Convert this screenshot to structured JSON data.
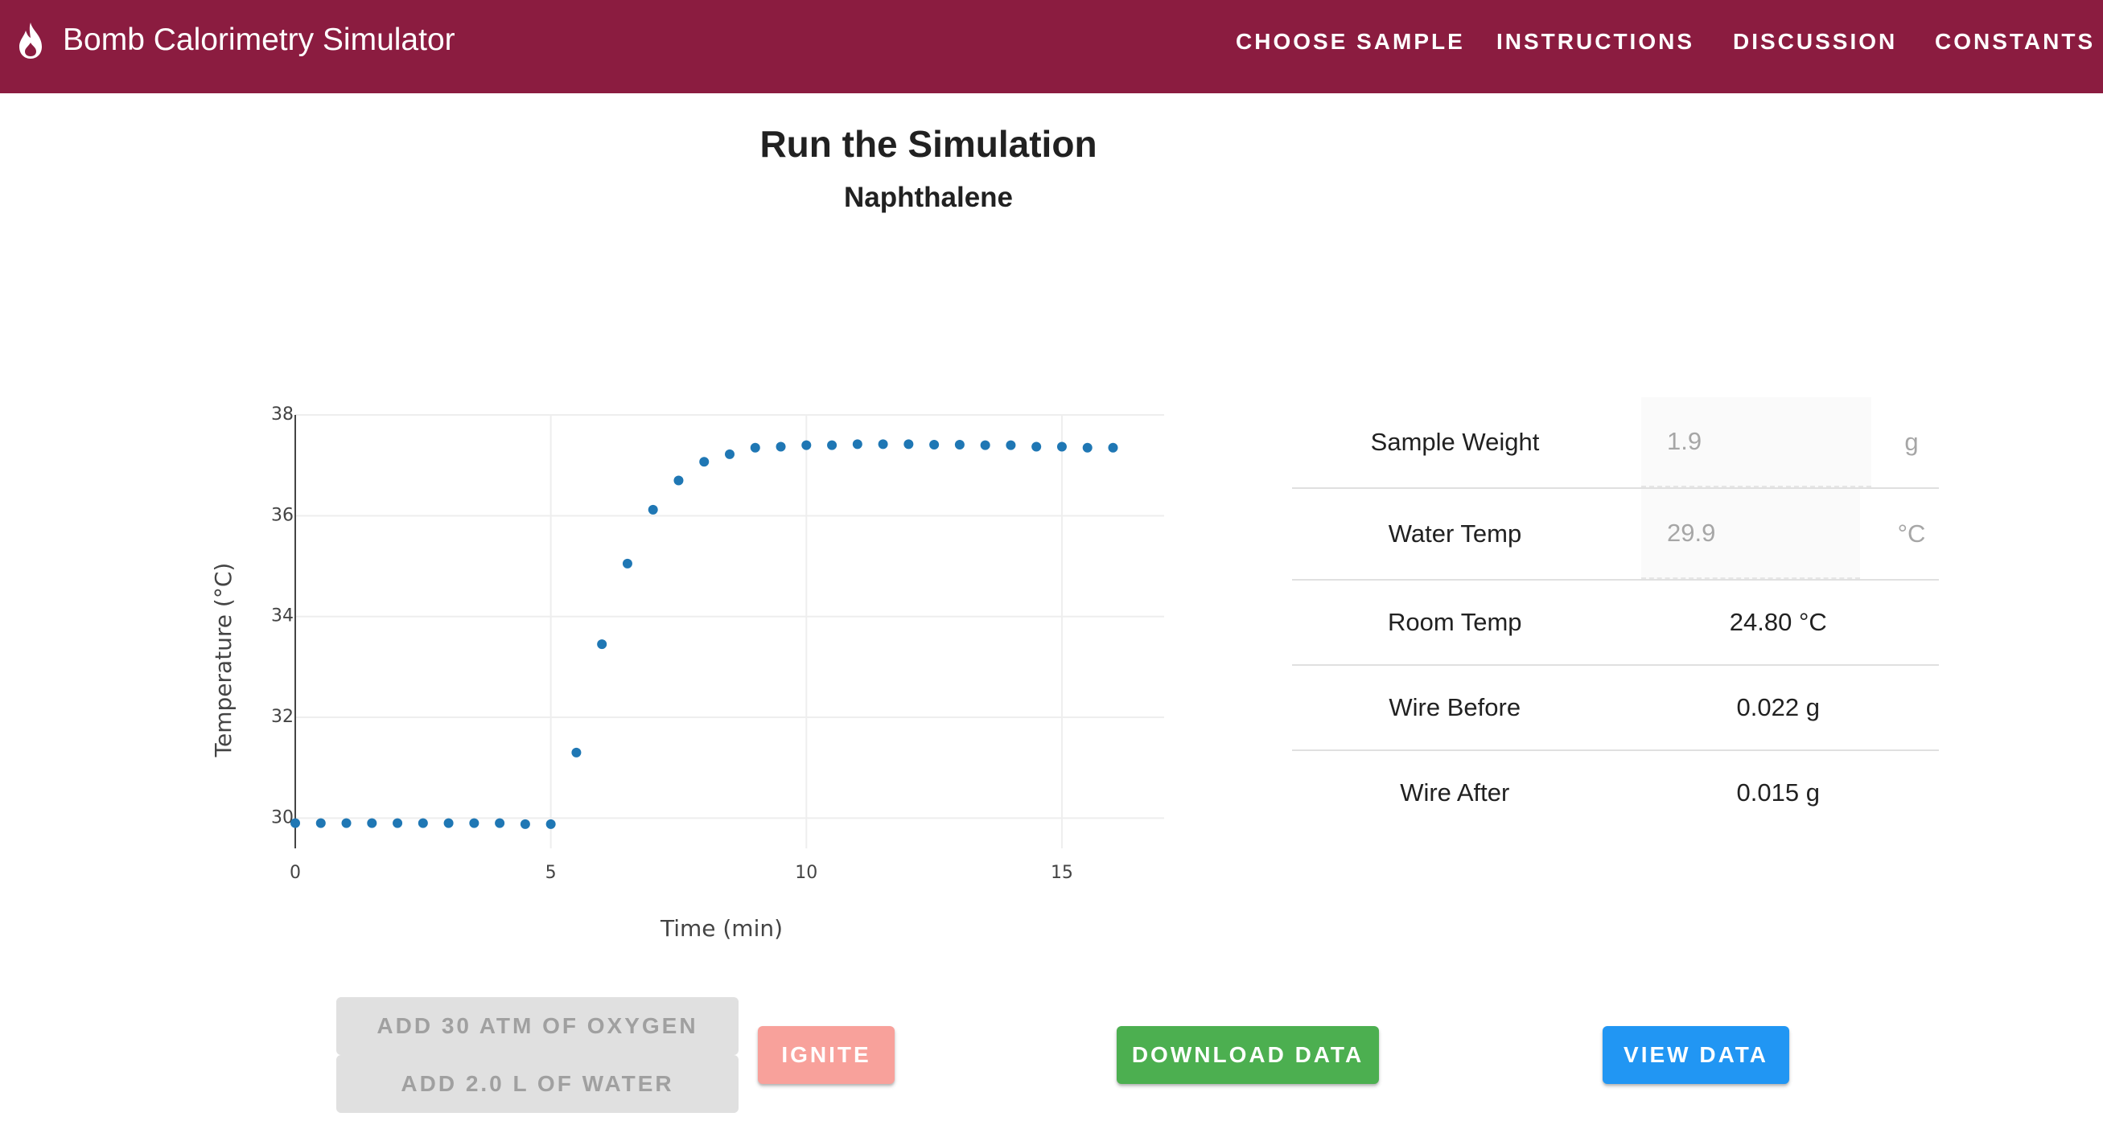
{
  "app": {
    "title": "Bomb Calorimetry Simulator",
    "logo_icon": "flame-icon",
    "brand_color": "#8b1c40"
  },
  "nav": [
    {
      "label": "CHOOSE SAMPLE"
    },
    {
      "label": "INSTRUCTIONS"
    },
    {
      "label": "DISCUSSION"
    },
    {
      "label": "CONSTANTS"
    }
  ],
  "main": {
    "title": "Run the Simulation",
    "sample_name": "Naphthalene"
  },
  "properties": {
    "sample_weight": {
      "label": "Sample Weight",
      "value": "1.9",
      "unit": "g"
    },
    "water_temp": {
      "label": "Water Temp",
      "value": "29.9",
      "unit": "°C"
    },
    "room_temp": {
      "label": "Room Temp",
      "value": "24.80 °C"
    },
    "wire_before": {
      "label": "Wire Before",
      "value": "0.022 g"
    },
    "wire_after": {
      "label": "Wire After",
      "value": "0.015 g"
    }
  },
  "buttons": {
    "add_oxygen": "ADD 30 ATM OF OXYGEN",
    "add_water": "ADD 2.0 L OF WATER",
    "ignite": "IGNITE",
    "download": "DOWNLOAD DATA",
    "view": "VIEW DATA"
  },
  "colors": {
    "marker": "#1f77b4",
    "ignite": "#f8a19b",
    "download": "#4caf50",
    "view": "#2196f3"
  },
  "chart_data": {
    "type": "scatter",
    "xlabel": "Time (min)",
    "ylabel": "Temperature (°C)",
    "xlim": [
      0,
      17
    ],
    "ylim": [
      29.4,
      38
    ],
    "x_ticks": [
      0,
      5,
      10,
      15
    ],
    "y_ticks": [
      30,
      32,
      34,
      36,
      38
    ],
    "grid": true,
    "legend": "none",
    "x": [
      0,
      0.5,
      1,
      1.5,
      2,
      2.5,
      3,
      3.5,
      4,
      4.5,
      5,
      5.5,
      6,
      6.5,
      7,
      7.5,
      8,
      8.5,
      9,
      9.5,
      10,
      10.5,
      11,
      11.5,
      12,
      12.5,
      13,
      13.5,
      14,
      14.5,
      15,
      15.5,
      16
    ],
    "y": [
      29.9,
      29.9,
      29.9,
      29.9,
      29.9,
      29.9,
      29.9,
      29.9,
      29.9,
      29.88,
      29.88,
      31.3,
      33.45,
      35.05,
      36.12,
      36.7,
      37.07,
      37.22,
      37.35,
      37.37,
      37.4,
      37.4,
      37.42,
      37.42,
      37.42,
      37.41,
      37.41,
      37.4,
      37.4,
      37.37,
      37.37,
      37.35,
      37.35
    ]
  }
}
